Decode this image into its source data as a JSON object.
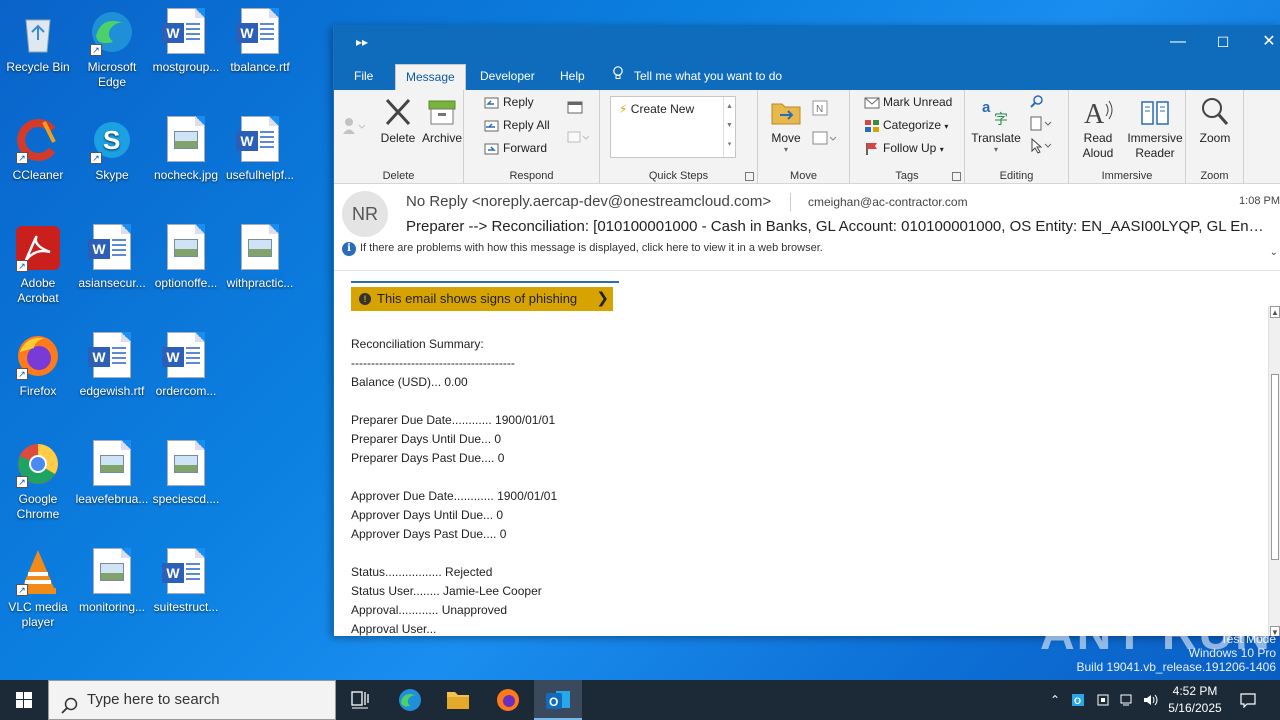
{
  "desktop": {
    "icons": [
      {
        "label": "Recycle Bin",
        "icon": "recycle-bin-icon"
      },
      {
        "label": "Microsoft Edge",
        "icon": "edge-icon"
      },
      {
        "label": "mostgroup...",
        "icon": "word-doc-icon"
      },
      {
        "label": "tbalance.rtf",
        "icon": "word-doc-icon"
      },
      {
        "label": "CCleaner",
        "icon": "ccleaner-icon"
      },
      {
        "label": "Skype",
        "icon": "skype-icon"
      },
      {
        "label": "nocheck.jpg",
        "icon": "image-file-icon"
      },
      {
        "label": "usefulhelpf...",
        "icon": "word-doc-icon"
      },
      {
        "label": "Adobe Acrobat",
        "icon": "acrobat-icon"
      },
      {
        "label": "asiansecur...",
        "icon": "word-doc-icon"
      },
      {
        "label": "optionoffe...",
        "icon": "image-file-icon"
      },
      {
        "label": "withpractic...",
        "icon": "image-file-icon"
      },
      {
        "label": "Firefox",
        "icon": "firefox-icon"
      },
      {
        "label": "edgewish.rtf",
        "icon": "word-doc-icon"
      },
      {
        "label": "ordercom...",
        "icon": "word-doc-icon"
      },
      {
        "label": "Google Chrome",
        "icon": "chrome-icon"
      },
      {
        "label": "leavefebrua...",
        "icon": "image-file-icon"
      },
      {
        "label": "speciescd....",
        "icon": "image-file-icon"
      },
      {
        "label": "VLC media player",
        "icon": "vlc-icon"
      },
      {
        "label": "monitoring...",
        "icon": "image-file-icon"
      },
      {
        "label": "suitestruct...",
        "icon": "word-doc-icon"
      }
    ]
  },
  "window": {
    "qat_glyph": "▸▸",
    "minimize": "—",
    "maximize": "☐",
    "close": "✕",
    "tabs": [
      "File",
      "Message",
      "Developer",
      "Help"
    ],
    "active_tab": "Message",
    "tell_me": "Tell me what you want to do"
  },
  "ribbon": {
    "delete_group": {
      "label": "Delete",
      "delete": "Delete",
      "archive": "Archive"
    },
    "respond_group": {
      "label": "Respond",
      "reply": "Reply",
      "reply_all": "Reply All",
      "forward": "Forward"
    },
    "quick_steps_group": {
      "label": "Quick Steps",
      "create_new": "Create New"
    },
    "move_group": {
      "label": "Move",
      "move": "Move"
    },
    "tags_group": {
      "label": "Tags",
      "mark_unread": "Mark Unread",
      "categorize": "Categorize",
      "follow_up": "Follow Up"
    },
    "editing_group": {
      "label": "Editing",
      "translate": "Translate"
    },
    "immersive_group": {
      "label": "Immersive",
      "read_aloud": "Read Aloud",
      "immersive_reader": "Immersive Reader"
    },
    "zoom_group": {
      "label": "Zoom",
      "zoom": "Zoom"
    }
  },
  "message": {
    "avatar_initials": "NR",
    "from": "No Reply <noreply.aercap-dev@onestreamcloud.com>",
    "to": "cmeighan@ac-contractor.com",
    "time": "1:08 PM",
    "subject": "Preparer --> Reconciliation: [010100001000 - Cash in Banks, GL Account: 010100001000, OS Entity: EN_AASI00LYQP, GL Entity: ...",
    "info_bar": "If there are problems with how this message is displayed, click here to view it in a web browser.",
    "phishing_warning": "This email shows signs of phishing",
    "body_lines": [
      "Reconciliation Summary:",
      "-----------------------------------------",
      "Balance (USD)... 0.00",
      "",
      "Preparer Due Date............ 1900/01/01",
      "Preparer Days Until Due... 0",
      "Preparer Days Past Due.... 0",
      "",
      "Approver Due Date............ 1900/01/01",
      "Approver Days Until Due... 0",
      "Approver Days Past Due.... 0",
      "",
      "Status................. Rejected",
      "Status User........ Jamie-Lee Cooper",
      "Approval............ Unapproved",
      "Approval User..."
    ]
  },
  "watermark": {
    "brand": "ANY RUN",
    "line1": "Test Mode",
    "line2": "Windows 10 Pro",
    "line3": "Build 19041.vb_release.191206-1406"
  },
  "taskbar": {
    "search_placeholder": "Type here to search",
    "time": "4:52 PM",
    "date": "5/16/2025"
  },
  "colors": {
    "outlook_blue": "#0f6cbd",
    "phishing_banner": "#d6a300",
    "taskbar": "#1c2a38"
  }
}
